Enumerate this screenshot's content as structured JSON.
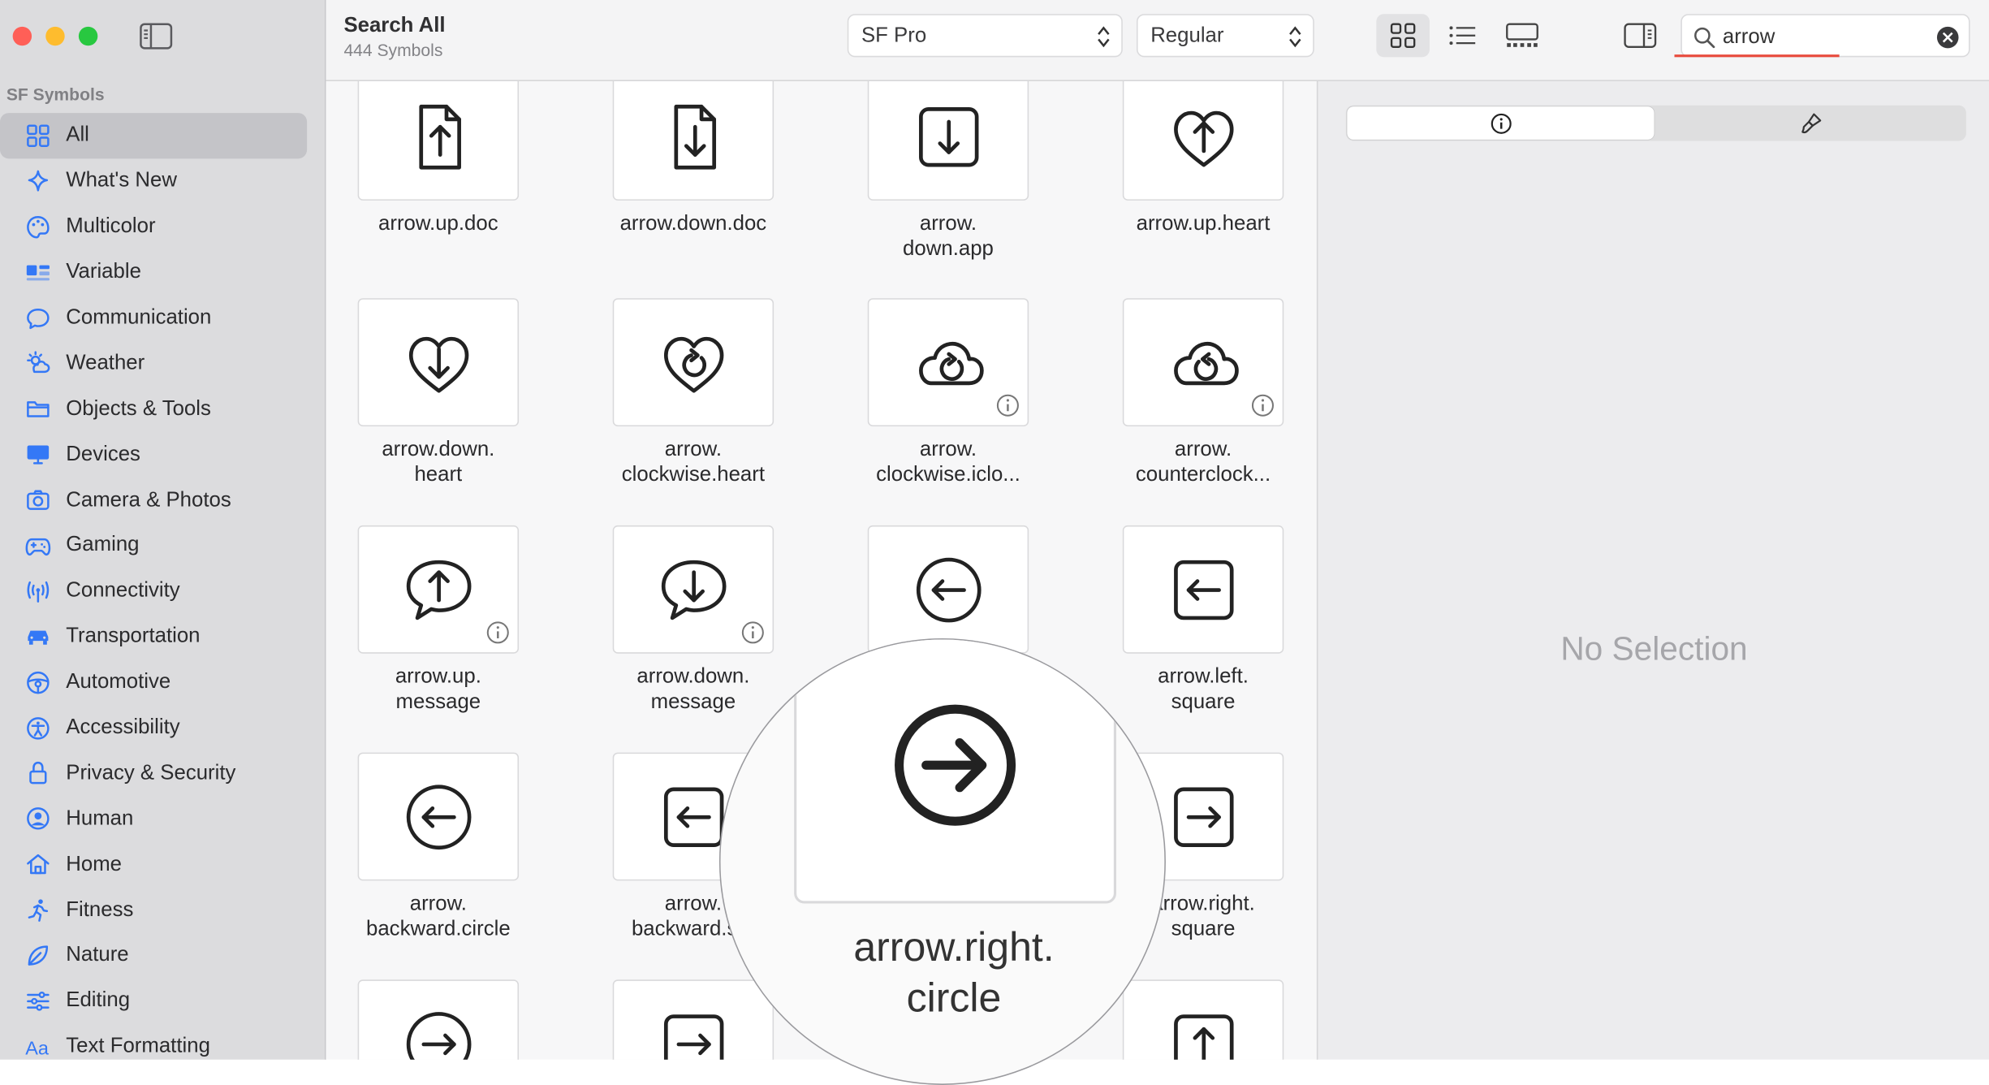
{
  "sidebar": {
    "section_title": "SF Symbols",
    "items": [
      {
        "label": "All",
        "icon": "grid-icon",
        "selected": true
      },
      {
        "label": "What's New",
        "icon": "sparkle-icon"
      },
      {
        "label": "Multicolor",
        "icon": "paintpalette-icon"
      },
      {
        "label": "Variable",
        "icon": "variable-icon"
      },
      {
        "label": "Communication",
        "icon": "bubble-icon"
      },
      {
        "label": "Weather",
        "icon": "sun-cloud-icon"
      },
      {
        "label": "Objects & Tools",
        "icon": "folder-icon"
      },
      {
        "label": "Devices",
        "icon": "display-icon"
      },
      {
        "label": "Camera & Photos",
        "icon": "camera-icon"
      },
      {
        "label": "Gaming",
        "icon": "gamecontroller-icon"
      },
      {
        "label": "Connectivity",
        "icon": "antenna-icon"
      },
      {
        "label": "Transportation",
        "icon": "car-icon"
      },
      {
        "label": "Automotive",
        "icon": "steeringwheel-icon"
      },
      {
        "label": "Accessibility",
        "icon": "accessibility-icon"
      },
      {
        "label": "Privacy & Security",
        "icon": "lock-icon"
      },
      {
        "label": "Human",
        "icon": "person-circle-icon"
      },
      {
        "label": "Home",
        "icon": "house-icon"
      },
      {
        "label": "Fitness",
        "icon": "figure-run-icon"
      },
      {
        "label": "Nature",
        "icon": "leaf-icon"
      },
      {
        "label": "Editing",
        "icon": "slider-icon"
      },
      {
        "label": "Text Formatting",
        "icon": "textformat-icon"
      }
    ]
  },
  "toolbar": {
    "title": "Search All",
    "subtitle": "444 Symbols",
    "font_select": "SF Pro",
    "weight_select": "Regular",
    "search_value": "arrow"
  },
  "symbols": [
    {
      "name": "arrow.up.doc",
      "info": false
    },
    {
      "name": "arrow.down.doc",
      "info": false
    },
    {
      "name": "arrow.\ndown.app",
      "info": false
    },
    {
      "name": "arrow.up.heart",
      "info": false
    },
    {
      "name": "arrow.down.\nheart",
      "info": false
    },
    {
      "name": "arrow.\nclockwise.heart",
      "info": false
    },
    {
      "name": "arrow.\nclockwise.iclo...",
      "info": true
    },
    {
      "name": "arrow.\ncounterclock...",
      "info": true
    },
    {
      "name": "arrow.up.\nmessage",
      "info": true
    },
    {
      "name": "arrow.down.\nmessage",
      "info": true
    },
    {
      "name": "",
      "info": false
    },
    {
      "name": "arrow.left.\nsquare",
      "info": false
    },
    {
      "name": "arrow.\nbackward.circle",
      "info": false
    },
    {
      "name": "arrow.\nbackward.s...",
      "info": false
    },
    {
      "name": "",
      "info": false
    },
    {
      "name": "arrow.right.\nsquare",
      "info": false
    },
    {
      "name": "",
      "info": false
    },
    {
      "name": "",
      "info": false
    },
    {
      "name": "",
      "info": false
    },
    {
      "name": "",
      "info": false
    }
  ],
  "magnifier": {
    "name": "arrow.right.\ncircle"
  },
  "inspector": {
    "empty_text": "No Selection"
  }
}
